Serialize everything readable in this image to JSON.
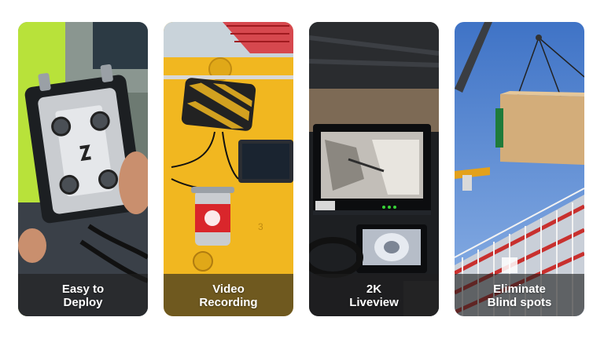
{
  "cards": [
    {
      "line1": "Easy to",
      "line2": "Deploy"
    },
    {
      "line1": "Video",
      "line2": "Recording"
    },
    {
      "line1": "2K",
      "line2": "Liveview"
    },
    {
      "line1": "Eliminate",
      "line2": "Blind spots"
    }
  ],
  "colors": {
    "accent_red": "#d9262b",
    "safety_yellow": "#f1b720",
    "sky_blue": "#5d8fd6"
  }
}
